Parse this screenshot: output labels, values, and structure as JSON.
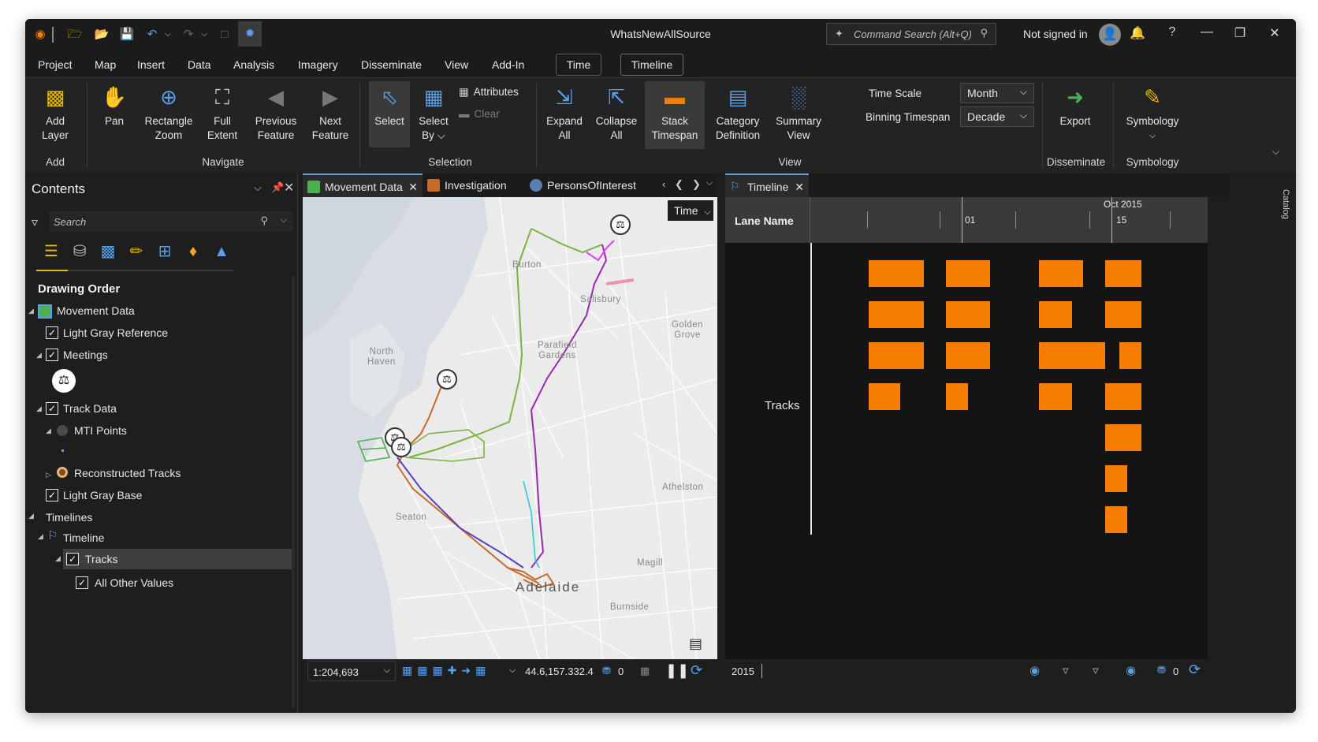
{
  "title_bar": {
    "title": "WhatsNewAllSource",
    "command_search_placeholder": "Command Search (Alt+Q)",
    "account_status": "Not signed in",
    "help": "?"
  },
  "menu": {
    "items": [
      "Project",
      "Map",
      "Insert",
      "Data",
      "Analysis",
      "Imagery",
      "Disseminate",
      "View",
      "Add-In"
    ],
    "context_tabs": [
      "Time",
      "Timeline"
    ]
  },
  "ribbon": {
    "add_group": {
      "label": "Add",
      "add_layer": "Add\nLayer"
    },
    "navigate_group": {
      "label": "Navigate",
      "pan": "Pan",
      "rectangle_zoom": "Rectangle\nZoom",
      "full_extent": "Full\nExtent",
      "previous_feature": "Previous\nFeature",
      "next_feature": "Next\nFeature"
    },
    "selection_group": {
      "label": "Selection",
      "select": "Select",
      "select_by": "Select\nBy ⌵",
      "attributes": "Attributes",
      "clear": "Clear"
    },
    "view_group": {
      "label": "View",
      "expand_all": "Expand\nAll",
      "collapse_all": "Collapse\nAll",
      "stack_timespan": "Stack\nTimespan",
      "category_definition": "Category\nDefinition",
      "summary_view": "Summary\nView",
      "time_scale_label": "Time Scale",
      "time_scale_value": "Month",
      "binning_timespan_label": "Binning Timespan",
      "binning_timespan_value": "Decade"
    },
    "disseminate_group": {
      "label": "Disseminate",
      "export": "Export"
    },
    "symbology_group": {
      "label": "Symbology",
      "symbology": "Symbology"
    }
  },
  "contents": {
    "title": "Contents",
    "search_placeholder": "Search",
    "drawing_order": "Drawing Order",
    "tree": {
      "movement_data": "Movement Data",
      "light_gray_reference": "Light Gray Reference",
      "meetings": "Meetings",
      "track_data": "Track Data",
      "mti_points": "MTI Points",
      "reconstructed_tracks": "Reconstructed Tracks",
      "light_gray_base": "Light Gray Base",
      "timelines": "Timelines",
      "timeline": "Timeline",
      "tracks": "Tracks",
      "all_other_values": "All Other Values"
    }
  },
  "map_tabs": {
    "movement_data": "Movement Data",
    "investigation": "Investigation",
    "persons_of_interest": "PersonsOfInterest"
  },
  "map": {
    "time_button": "Time",
    "labels": {
      "burton": "Burton",
      "salisbury": "Salisbury",
      "golden_grove": "Golden\nGrove",
      "parafield_gardens": "Parafield\nGardens",
      "north_haven": "North\nHaven",
      "athelston": "Athelston",
      "seaton": "Seaton",
      "magill": "Magill",
      "adelaide": "Adelaide",
      "burnside": "Burnside"
    },
    "status": {
      "scale": "1:204,693",
      "coordinates": "44.6,157.332.4",
      "selected_count": "0"
    }
  },
  "timeline": {
    "tab": "Timeline",
    "lane_header": "Lane Name",
    "month_label": "Oct 2015",
    "tick_labels": [
      "01",
      "15"
    ],
    "lane": "Tracks",
    "status_year": "2015",
    "selected_count": "0"
  },
  "catalog_tab": "Catalog",
  "colors": {
    "bar": "#f57d00",
    "accent": "#5aa0e6",
    "track_green": "#7cb342",
    "track_purple": "#9c27b0",
    "track_orange": "#c66a2c"
  }
}
